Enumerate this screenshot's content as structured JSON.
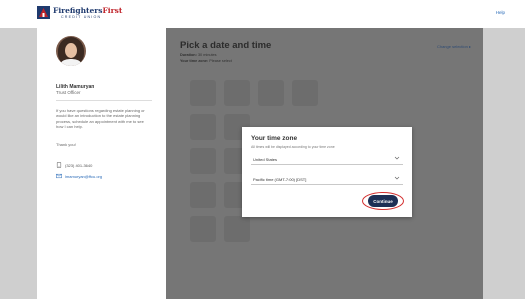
{
  "header": {
    "logo_text_main": "Firefighters",
    "logo_text_accent": "First",
    "logo_subtext": "CREDIT UNION",
    "help_label": "Help"
  },
  "sidebar": {
    "advisor_name": "Lilith Mamuryan",
    "advisor_title": "Trust Officer",
    "message": "If you have questions regarding estate planning or would like an introduction to the estate planning process, schedule an appointment with me to see how I can help.",
    "thanks": "Thank you!",
    "phone": "(323) 401-3640",
    "email": "lmamuryan@ffcu.org"
  },
  "panel": {
    "title": "Pick a date and time",
    "duration_label": "Duration:",
    "duration_value": "30 minutes",
    "timezone_label": "Your time zone:",
    "timezone_value": "Please select",
    "change_selection": "Change selection ▸"
  },
  "modal": {
    "title": "Your time zone",
    "subtitle": "All times will be displayed according to your time zone",
    "country_value": "United States",
    "timezone_value": "Pacific time (GMT-7:00) [DST]",
    "continue_label": "Continue"
  },
  "colors": {
    "brand_navy": "#1d2f55",
    "brand_red": "#c0242b",
    "highlight": "#d32f2f",
    "link": "#2a6bb8"
  },
  "icons": [
    "logo-icon",
    "phone-icon",
    "email-icon",
    "chevron-down-icon"
  ]
}
